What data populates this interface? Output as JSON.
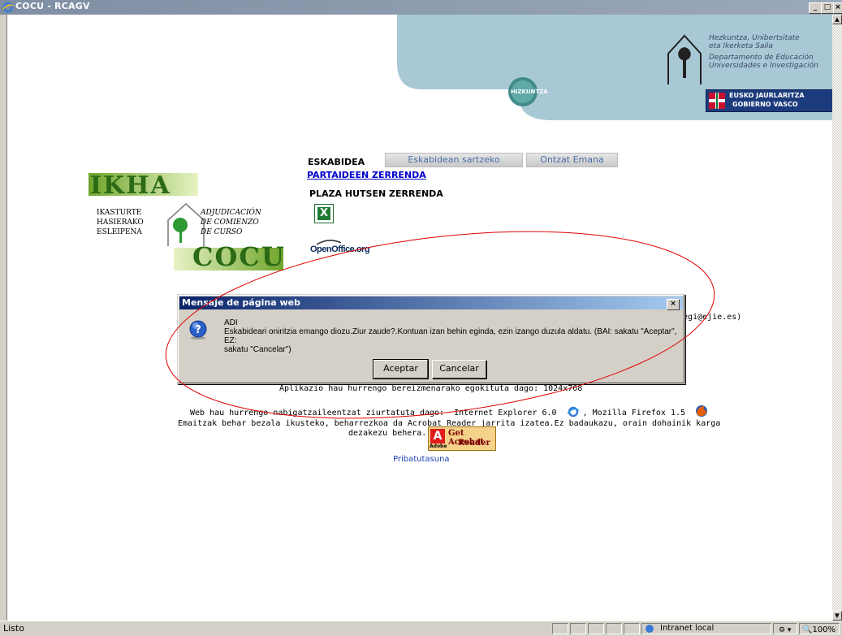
{
  "window": {
    "title": "COCU - RCAGV",
    "controls": [
      "_",
      "□",
      "×"
    ]
  },
  "banner": {
    "dept_lines": [
      "Hezkuntza, Unibertsitate",
      "eta Ikerketa Saila",
      "Departamento de Educación",
      "Universidades e Investigación"
    ],
    "hizkuntza": "HIZKUNTZA",
    "gov_lines": [
      "EUSKO JAURLARITZA",
      "GOBIERNO VASCO"
    ]
  },
  "logo": {
    "ikha": "IKHA",
    "left_lines": [
      "IKASTURTE",
      "HASIERAKO",
      "ESLEIPENA"
    ],
    "right_lines": [
      "ADJUDICACIÓN",
      "DE COMIENZO",
      "DE CURSO"
    ],
    "cocu": "COCU"
  },
  "menu": {
    "eskabidea_label": "ESKABIDEA",
    "tab_enter": "Eskabidean sartzeko",
    "tab_approved": "Ontzat Emana",
    "partaideen": "PARTAIDEEN ZERRENDA",
    "plaza_hutsen": "PLAZA HUTSEN ZERRENDA",
    "openoffice_logo": "OpenOffice.org"
  },
  "info": {
    "email_fragment": "stegi@ejie.es)",
    "resolution": "Aplikazio hau hurrengo bereizmenarako egokituta dago: 1024x768",
    "browsers_prefix": "Web hau hurrengo nabigatzaileentzat ziurtatuta dago:",
    "ie": "Internet Explorer 6.0",
    "firefox": ", Mozilla Firefox 1.5",
    "acrobat_line1": "Emaitzak behar bezala ikusteko, beharrezkoa da Acrobat Reader jarrita izatea.Ez badaukazu, orain dohainik karga",
    "acrobat_line2": "dezakezu behera.",
    "acrobat_badge_1": "Get Acrobat",
    "acrobat_badge_2": "Reader",
    "acrobat_badge_adobe": "Adobe",
    "privacy": "Pribatutasuna"
  },
  "dialog": {
    "title": "Mensaje de página web",
    "close": "×",
    "heading": "ADI",
    "message_1": "Eskabideari oniritzia emango diozu.Ziur zaude?.Kontuan izan behin eginda, ezin izango duzula aldatu. (BAI: sakatu \"Aceptar\", EZ:",
    "message_2": "sakatu \"Cancelar\")",
    "ok": "Aceptar",
    "cancel": "Cancelar"
  },
  "status": {
    "left": "Listo",
    "zone": "Intranet local",
    "zoom": "100%"
  },
  "colors": {
    "annotation_ellipse": "#e00000",
    "dialog_title": "#0a246a",
    "link": "#0000cc"
  }
}
